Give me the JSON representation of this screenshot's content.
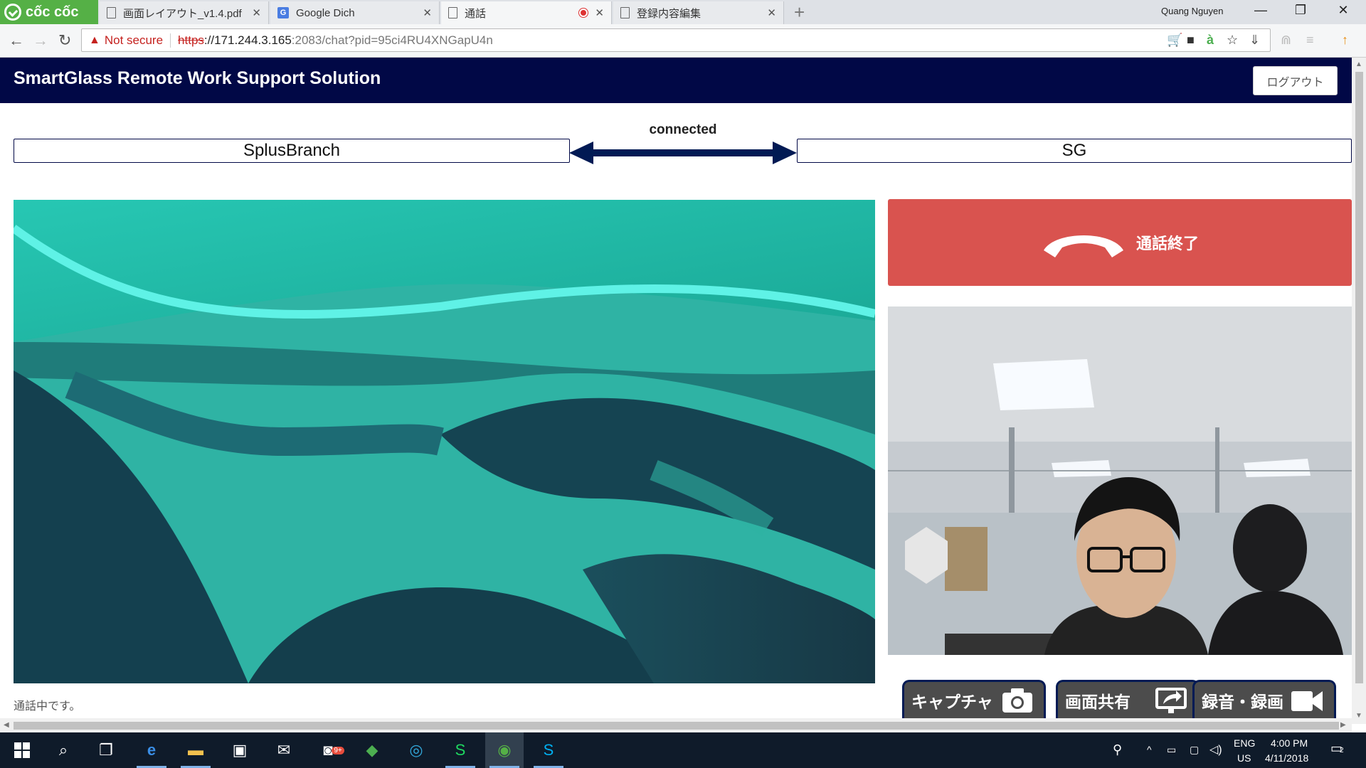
{
  "browser": {
    "brand": "cốc cốc",
    "tabs": [
      {
        "title": "画面レイアウト_v1.4.pdf"
      },
      {
        "title": "Google Dich"
      },
      {
        "title": "通話"
      },
      {
        "title": "登録内容編集"
      }
    ],
    "profile_name": "Quang Nguyen",
    "address": {
      "security_label": "Not secure",
      "scheme": "https",
      "host": "://171.244.3.165",
      "path": ":2083/chat?pid=95ci4RU4XNGapU4n"
    }
  },
  "app": {
    "title": "SmartGlass Remote Work Support Solution",
    "logout_label": "ログアウト",
    "connection_status": "connected",
    "local_peer": "SplusBranch",
    "remote_peer": "SG",
    "end_call_label": "通話終了",
    "actions": {
      "capture": "キャプチャ",
      "screen_share": "画面共有",
      "record": "録音・録画"
    },
    "status_message": "通話中です。",
    "colors": {
      "header_bg": "#010846",
      "end_call": "#d9534f",
      "arrow": "#011a54"
    }
  },
  "taskbar": {
    "lang": "ENG",
    "region": "US",
    "time": "4:00 PM",
    "date": "4/11/2018",
    "notification_count": "2",
    "badge": "9+"
  }
}
